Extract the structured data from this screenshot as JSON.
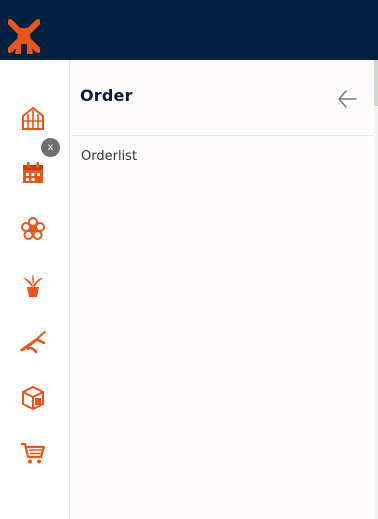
{
  "colors": {
    "topbar": "#02203f",
    "accent": "#e8561b",
    "panel_bg": "#fefbfd",
    "title": "#0b1b33",
    "badge": "#6e6e6e"
  },
  "topbar": {
    "logo_icon": "windmill-logo-icon"
  },
  "rail": {
    "items": [
      {
        "icon": "greenhouse-icon"
      },
      {
        "icon": "calendar-icon"
      },
      {
        "icon": "flower-icon"
      },
      {
        "icon": "potted-plant-icon"
      },
      {
        "icon": "pruning-shears-icon"
      },
      {
        "icon": "package-icon"
      },
      {
        "icon": "shopping-cart-icon"
      }
    ],
    "badge_label": "x"
  },
  "panel": {
    "title": "Order",
    "back_icon": "arrow-left-icon",
    "items": [
      {
        "label": "Orderlist"
      }
    ]
  }
}
